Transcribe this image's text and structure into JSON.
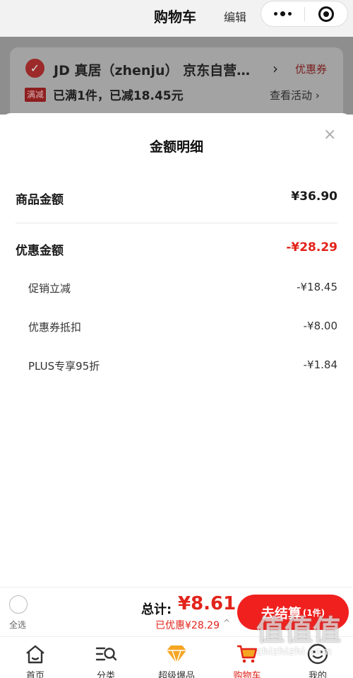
{
  "header": {
    "title": "购物车",
    "edit_label": "编辑"
  },
  "store": {
    "name": "JD 真居（zhenju） 京东自营…",
    "coupon_link": "优惠券",
    "promo_tag": "满减",
    "promo_text": "已满1件，已减18.45元",
    "promo_link": "查看活动 ›"
  },
  "sheet": {
    "title": "金额明细",
    "close_icon": "×",
    "goods_label": "商品金额",
    "goods_value": "¥36.90",
    "discount_label": "优惠金额",
    "discount_value": "-¥28.29",
    "items": [
      {
        "label": "促销立减",
        "value": "-¥18.45"
      },
      {
        "label": "优惠券抵扣",
        "value": "-¥8.00"
      },
      {
        "label": "PLUS专享95折",
        "value": "-¥1.84"
      }
    ]
  },
  "bottom": {
    "select_all": "全选",
    "total_label": "总计:",
    "total_value": "¥8.61",
    "saved_text": "已优惠¥28.29",
    "saved_caret": "^",
    "checkout_label": "去结算",
    "checkout_count": "(1件)"
  },
  "tabs": [
    {
      "label": "首页",
      "icon": "home-icon"
    },
    {
      "label": "分类",
      "icon": "category-search-icon"
    },
    {
      "label": "超级爆品",
      "icon": "diamond-icon"
    },
    {
      "label": "购物车",
      "icon": "cart-icon"
    },
    {
      "label": "我的",
      "icon": "smile-icon"
    }
  ],
  "watermark": {
    "big": "值值值",
    "small": "zhizhizhi.com"
  },
  "colors": {
    "accent": "#e2231a",
    "checkout": "#f0201e",
    "diamond": "#f5a623"
  }
}
